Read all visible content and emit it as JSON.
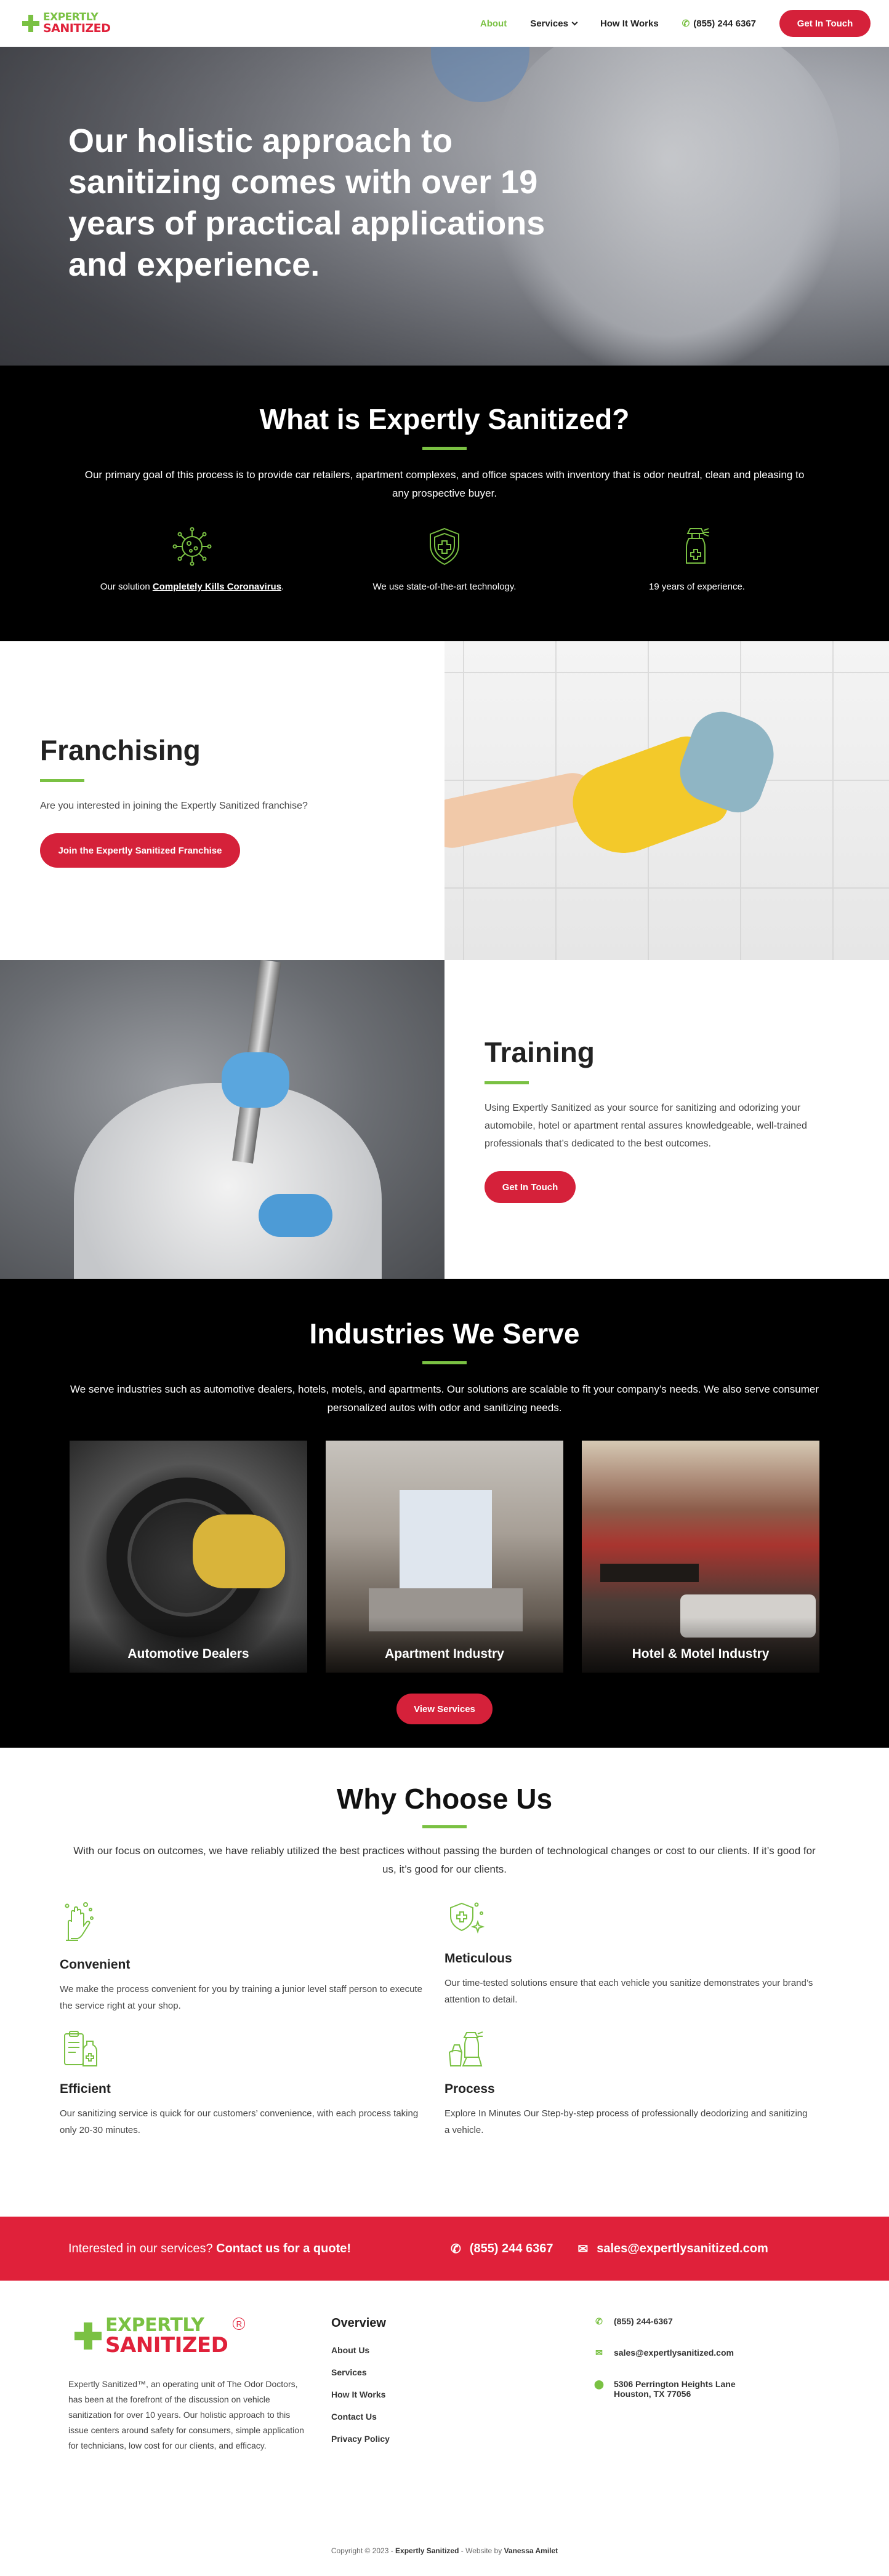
{
  "header": {
    "logo_line1": "EXPERTLY",
    "logo_line2": "SANITIZED",
    "logo_r": "R",
    "nav": [
      {
        "label": "About"
      },
      {
        "label": "Services"
      },
      {
        "label": "How It Works"
      }
    ],
    "phone": "(855) 244 6367",
    "cta": "Get In Touch"
  },
  "hero": {
    "title": "Our holistic approach to sanitizing comes with over 19 years of practical applications and experience."
  },
  "what": {
    "title": "What is Expertly Sanitized?",
    "intro": "Our primary goal of this process is to provide car retailers, apartment complexes, and office spaces with inventory that is odor neutral, clean and pleasing to any prospective buyer.",
    "f1_prefix": "Our solution ",
    "f1_link": "Completely Kills Coronavirus",
    "f1_suffix": ".",
    "f2": "We use state-of-the-art technology.",
    "f3": "19 years of experience."
  },
  "franchising": {
    "title": "Franchising",
    "text": "Are you interested in joining the Expertly Sanitized franchise?",
    "button": "Join the Expertly Sanitized Franchise"
  },
  "training": {
    "title": "Training",
    "text": "Using Expertly Sanitized as your source for sanitizing and odorizing your automobile, hotel or apartment rental assures knowledgeable, well-trained professionals that’s dedicated to the best outcomes.",
    "button": "Get In Touch"
  },
  "industries": {
    "title": "Industries We Serve",
    "intro": "We serve industries such as automotive dealers, hotels, motels, and apartments. Our solutions are scalable to fit your company’s needs. We also serve consumer personalized autos with odor and sanitizing needs.",
    "cards": [
      {
        "label": "Automotive Dealers"
      },
      {
        "label": "Apartment Industry"
      },
      {
        "label": "Hotel & Motel Industry"
      }
    ],
    "button": "View Services"
  },
  "why": {
    "title": "Why Choose Us",
    "intro": "With our focus on outcomes, we have reliably utilized the best practices without passing the burden of technological changes or cost to our clients. If it’s good for us, it’s good for our clients.",
    "items": [
      {
        "title": "Convenient",
        "text": "We make the process convenient for you by training a junior level staff person to execute the service right at your shop."
      },
      {
        "title": "Meticulous",
        "text": "Our time-tested solutions ensure that each vehicle you sanitize demonstrates your brand’s attention to detail."
      },
      {
        "title": "Efficient",
        "text": "Our sanitizing service is quick for our customers’ convenience, with each process taking only 20-30 minutes."
      },
      {
        "title": "Process",
        "text": "Explore In Minutes Our Step-by-step process of professionally deodorizing and sanitizing a vehicle."
      }
    ]
  },
  "cta_bar": {
    "question": "Interested in our services? ",
    "question_bold": "Contact us for a quote!",
    "phone": "(855) 244 6367",
    "email": "sales@expertlysanitized.com"
  },
  "footer": {
    "about": "Expertly Sanitized™, an operating unit of The Odor Doctors, has been at the forefront of the discussion on vehicle sanitization for over 10 years. Our holistic approach to this issue centers around safety for consumers, simple application for technicians, low cost for our clients, and efficacy.",
    "overview_title": "Overview",
    "links": [
      "About Us",
      "Services",
      "How It Works",
      "Contact Us",
      "Privacy Policy"
    ],
    "phone": "(855) 244-6367",
    "email": "sales@expertlysanitized.com",
    "address1": "5306 Perrington Heights Lane",
    "address2": "Houston, TX 77056",
    "copyright_prefix": "Copyright © 2023 - ",
    "copyright_brand": "Expertly Sanitized",
    "copyright_mid": " - Website by ",
    "copyright_author": "Vanessa Amilet"
  },
  "colors": {
    "brand_green": "#7ac143",
    "brand_red": "#d5213a",
    "cta_red": "#e0213a"
  }
}
